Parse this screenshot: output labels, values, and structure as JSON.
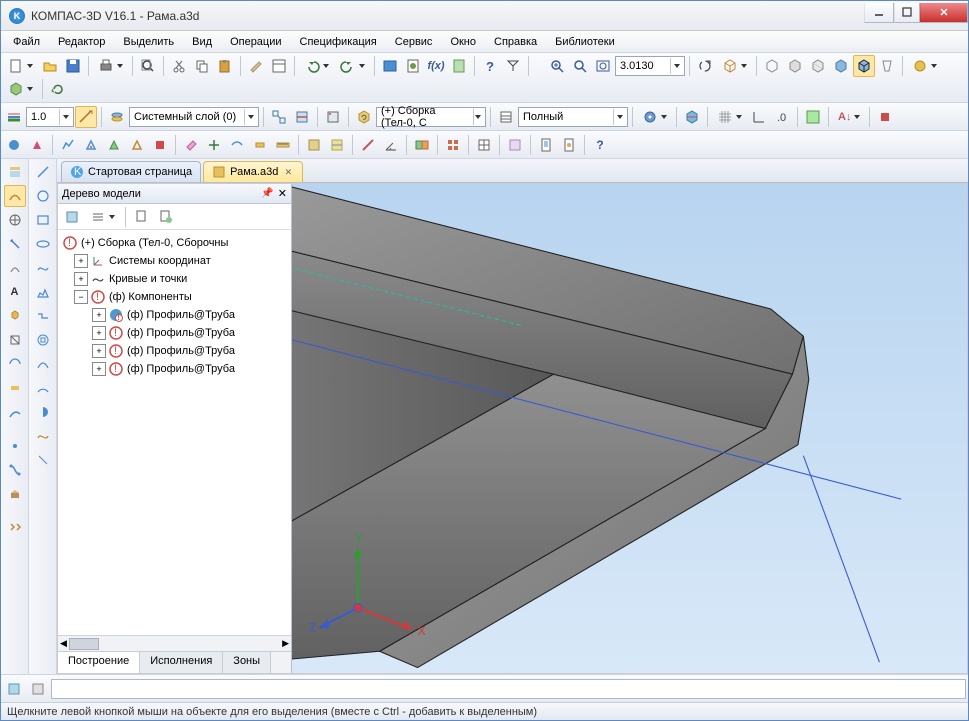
{
  "title": "КОМПАС-3D V16.1 - Рама.a3d",
  "menu": [
    "Файл",
    "Редактор",
    "Выделить",
    "Вид",
    "Операции",
    "Спецификация",
    "Сервис",
    "Окно",
    "Справка",
    "Библиотеки"
  ],
  "tb1": {
    "scale_val": "3.0130"
  },
  "tb2": {
    "lw": "1.0",
    "layer": "Системный слой (0)",
    "assembly": "(+) Сборка (Тел-0, С",
    "display": "Полный"
  },
  "tabs": {
    "start": "Стартовая страница",
    "doc": "Рама.a3d"
  },
  "panel": {
    "title": "Дерево модели",
    "root": "(+) Сборка (Тел-0, Сборочны",
    "n1": "Системы координат",
    "n2": "Кривые и точки",
    "n3": "(ф) Компоненты",
    "c1": "(ф) Профиль@Труба",
    "c2": "(ф) Профиль@Труба",
    "c3": "(ф) Профиль@Труба",
    "c4": "(ф) Профиль@Труба",
    "ptabs": [
      "Построение",
      "Исполнения",
      "Зоны"
    ]
  },
  "status": "Щелкните левой кнопкой мыши на объекте для его выделения (вместе с Ctrl - добавить к выделенным)"
}
